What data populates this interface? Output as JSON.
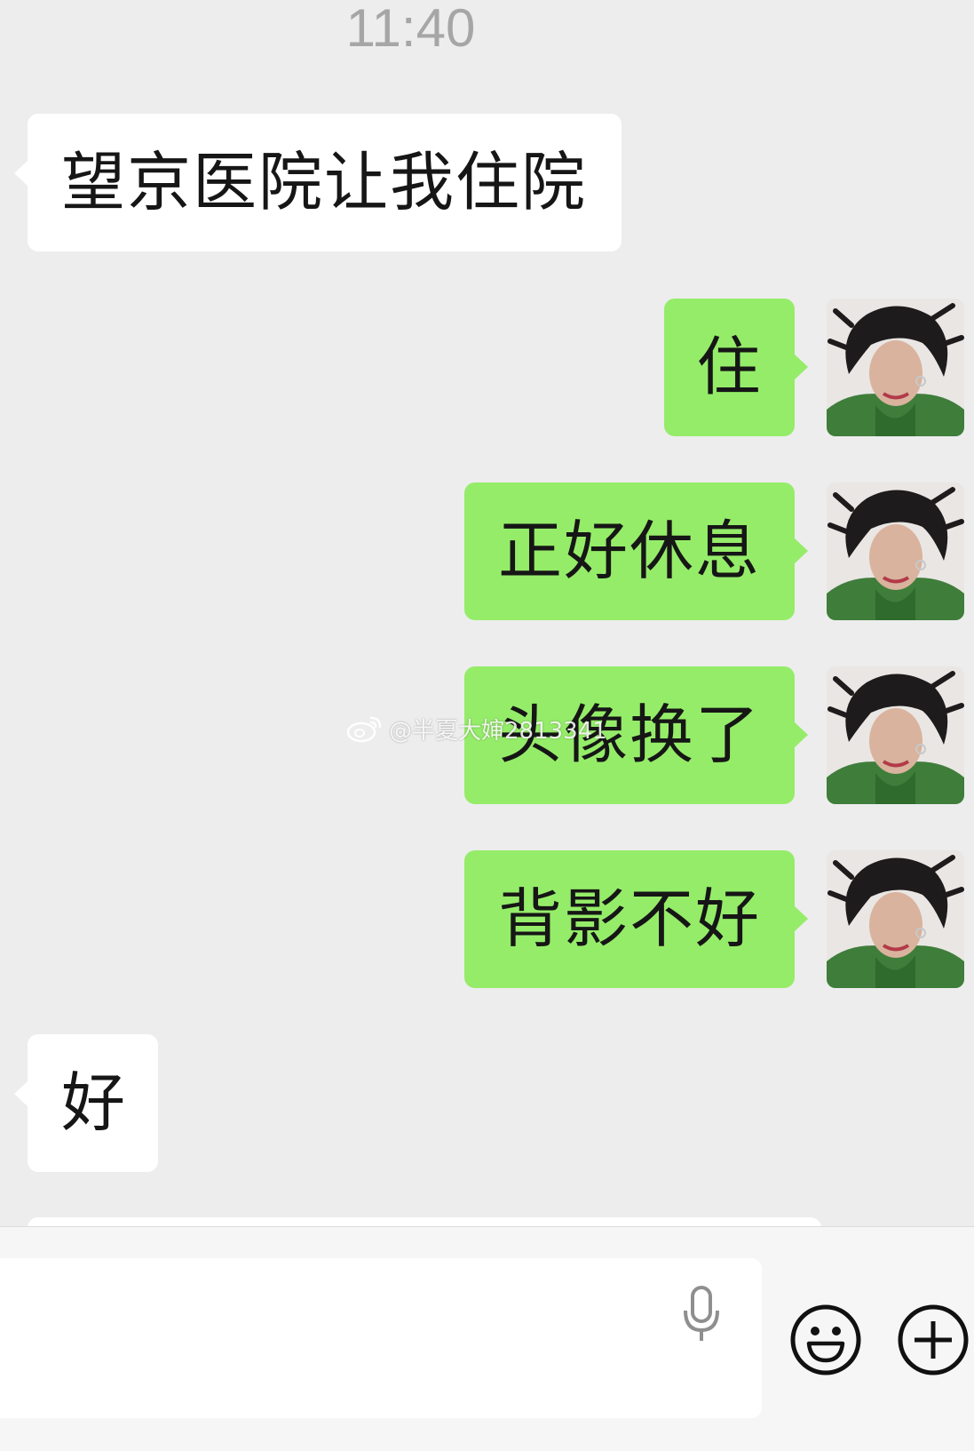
{
  "chat": {
    "timestamp": "11:40",
    "messages": [
      {
        "sender": "contact",
        "text": "望京医院让我住院"
      },
      {
        "sender": "me",
        "text": "住"
      },
      {
        "sender": "me",
        "text": "正好休息"
      },
      {
        "sender": "me",
        "text": "头像换了"
      },
      {
        "sender": "me",
        "text": "背影不好"
      },
      {
        "sender": "contact",
        "text": "好"
      }
    ]
  },
  "watermark": {
    "text": "@半夏大婶2813341"
  },
  "input_bar": {
    "icons": [
      "microphone-icon",
      "emoji-icon",
      "plus-icon"
    ]
  },
  "colors": {
    "background": "#ededed",
    "outgoing_bubble": "#95ec69",
    "incoming_bubble": "#ffffff",
    "timestamp": "#a6a6a6"
  }
}
